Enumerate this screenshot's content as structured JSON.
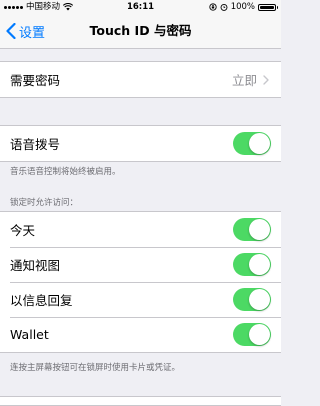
{
  "status_bar": {
    "carrier": "中国移动",
    "time": "16:11",
    "battery": "100%",
    "battery_level": 1.0
  },
  "nav": {
    "back_label": "设置",
    "title": "Touch ID 与密码"
  },
  "passcode": {
    "label": "需要密码",
    "value": "立即"
  },
  "voice_dial": {
    "label": "语音拨号",
    "enabled": true,
    "footnote": "音乐语音控制将始终被启用。"
  },
  "lock_access": {
    "header": "锁定时允许访问：",
    "items": [
      {
        "label": "今天",
        "enabled": true
      },
      {
        "label": "通知视图",
        "enabled": true
      },
      {
        "label": "以信息回复",
        "enabled": true
      },
      {
        "label": "Wallet",
        "enabled": true
      }
    ],
    "footnote": "连按主屏幕按钮可在锁屏时使用卡片或凭证。"
  },
  "colors": {
    "accent": "#007aff",
    "toggle_on": "#4cd964",
    "background": "#efeff4"
  },
  "icons": [
    "signal-icon",
    "wifi-icon",
    "orientation-lock-icon",
    "alarm-icon",
    "battery-icon",
    "chevron-left-icon",
    "chevron-right-icon"
  ]
}
